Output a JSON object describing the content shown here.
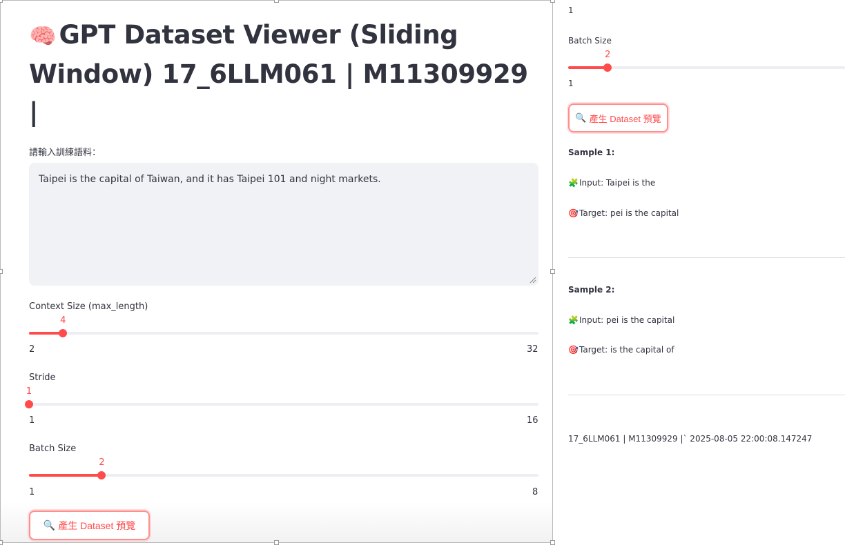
{
  "title": {
    "icon": "brain-icon",
    "icon_glyph": "🧠",
    "text": "GPT Dataset Viewer (Sliding Window) 17_6LLM061 | M11309929 |"
  },
  "corpus": {
    "label": "請輸入訓練語料：",
    "value": "Taipei is the capital of Taiwan, and it has Taipei 101 and night markets."
  },
  "context_size": {
    "label": "Context Size (max_length)",
    "value": "4",
    "min": "2",
    "max": "32",
    "fraction": 0.0667
  },
  "stride": {
    "label": "Stride",
    "value": "1",
    "min": "1",
    "max": "16",
    "fraction": 0.0
  },
  "batch_size": {
    "label": "Batch Size",
    "value": "2",
    "min": "1",
    "max": "8",
    "fraction": 0.1429
  },
  "preview_button": {
    "icon": "magnifier-icon",
    "icon_glyph": "🔍",
    "label": "產生 Dataset 預覽"
  },
  "right_panel": {
    "top_clipped_value": "1",
    "batch_size": {
      "label": "Batch Size",
      "value": "2",
      "min": "1",
      "fraction": 0.1429
    },
    "preview_button": {
      "icon": "magnifier-icon",
      "icon_glyph": "🔍",
      "label": "產生 Dataset 預覽"
    },
    "samples": [
      {
        "title": "Sample 1:",
        "input_icon": "puzzle-icon",
        "input_glyph": "🧩",
        "input": "Input: Taipei is the",
        "target_icon": "target-icon",
        "target_glyph": "🎯",
        "target": "Target: pei is the capital"
      },
      {
        "title": "Sample 2:",
        "input_icon": "puzzle-icon",
        "input_glyph": "🧩",
        "input": "Input: pei is the capital",
        "target_icon": "target-icon",
        "target_glyph": "🎯",
        "target": "Target: is the capital of"
      }
    ],
    "footer": "17_6LLM061 | M11309929 |` 2025-08-05 22:00:08.147247"
  },
  "colors": {
    "accent": "#ff4b4b",
    "track": "#eceef3",
    "textarea_bg": "#f0f2f6",
    "text": "#31333f"
  }
}
